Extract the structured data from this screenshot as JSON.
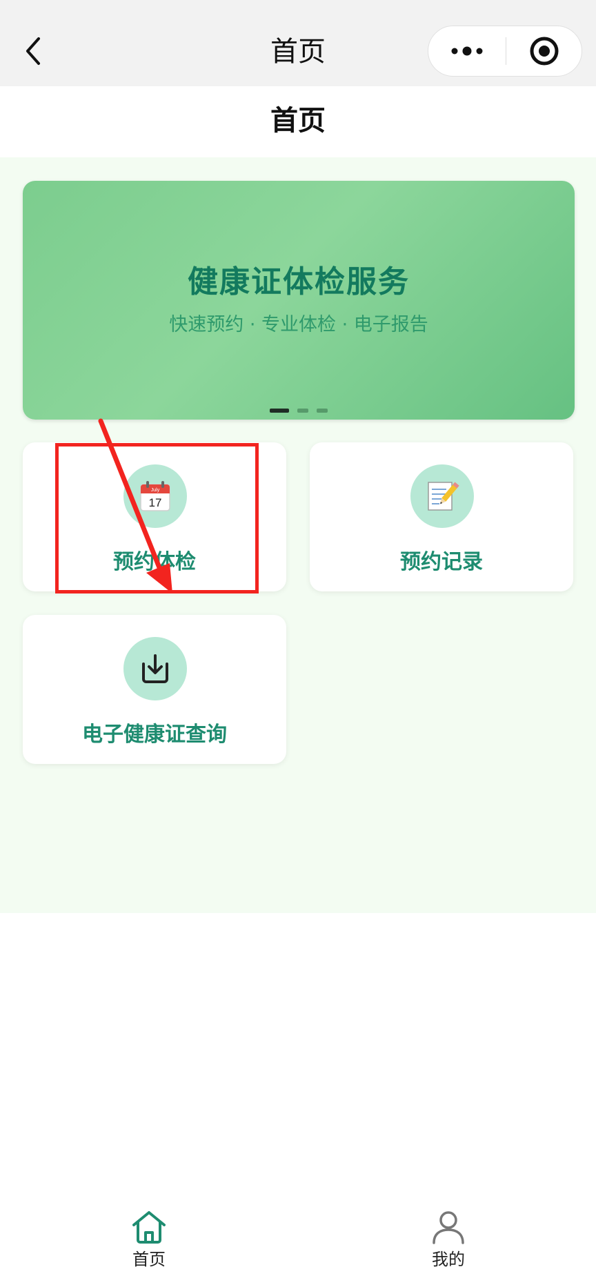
{
  "nav": {
    "title": "首页"
  },
  "page": {
    "header_title": "首页"
  },
  "banner": {
    "title": "健康证体检服务",
    "subtitle": "快速预约 · 专业体检 · 电子报告",
    "slide_count": 3,
    "active_slide": 1
  },
  "menu": {
    "items": [
      {
        "label": "预约体检",
        "icon": "calendar-icon"
      },
      {
        "label": "预约记录",
        "icon": "memo-icon"
      },
      {
        "label": "电子健康证查询",
        "icon": "download-icon"
      }
    ]
  },
  "tabbar": {
    "items": [
      {
        "label": "首页",
        "icon": "home-icon",
        "active": true
      },
      {
        "label": "我的",
        "icon": "user-icon",
        "active": false
      }
    ]
  },
  "colors": {
    "accent": "#1e8c70",
    "banner_green": "#7ccd8e",
    "annotation_red": "#f2241f"
  }
}
